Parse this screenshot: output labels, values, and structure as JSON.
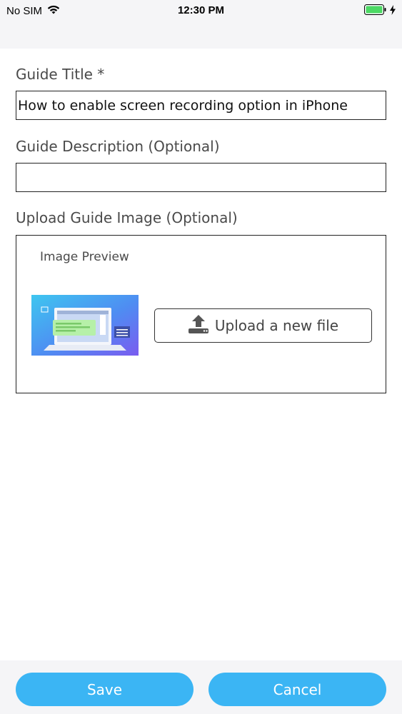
{
  "status_bar": {
    "carrier": "No SIM",
    "time": "12:30 PM",
    "wifi_icon": "wifi-icon",
    "battery_icon": "battery-icon",
    "charging_icon": "charging-bolt-icon"
  },
  "form": {
    "title_label": "Guide Title *",
    "title_value": "How to enable screen recording option in iPhone",
    "description_label": "Guide Description (Optional)",
    "description_value": "",
    "image_label": "Upload Guide Image (Optional)",
    "preview_label": "Image Preview",
    "upload_button_label": "Upload a new file",
    "upload_icon": "upload-icon"
  },
  "footer": {
    "save_label": "Save",
    "cancel_label": "Cancel"
  },
  "colors": {
    "accent": "#3bb5f4",
    "battery": "#4cd964",
    "bar_background": "#f5f5f7"
  }
}
